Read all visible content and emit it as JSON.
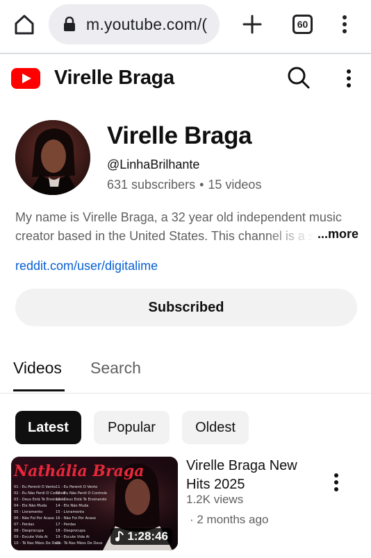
{
  "browser": {
    "url": "m.youtube.com/(",
    "tab_count": "60"
  },
  "header": {
    "channel_title": "Virelle Braga"
  },
  "channel": {
    "name": "Virelle Braga",
    "handle": "@LinhaBrilhante",
    "subscribers": "631 subscribers",
    "videos": "15 videos",
    "separator": "•",
    "description_line1": "My name is Virelle Braga, a 32 year old independent music",
    "description_line2": "creator based in the United States. This channel is a s",
    "more_label": "...more",
    "link": "reddit.com/user/digitalime",
    "subscribe_label": "Subscribed"
  },
  "tabs": [
    {
      "label": "Videos",
      "active": true
    },
    {
      "label": "Search",
      "active": false
    }
  ],
  "chips": [
    {
      "label": "Latest",
      "selected": true
    },
    {
      "label": "Popular",
      "selected": false
    },
    {
      "label": "Oldest",
      "selected": false
    }
  ],
  "videos": [
    {
      "title": "Virelle Braga New Hits 2025",
      "views": "1.2K views",
      "age": "· 2 months ago",
      "duration": "1:28:46",
      "thumbnail_text": "Nathália Braga",
      "thumbnail_tracks_left": [
        "01 - Eu Perenti O Vento",
        "02 - Eu Não Perdi O Controle",
        "03 - Deus Está Te Ensinando",
        "04 - Ele Não Muda",
        "05 - Livramento",
        "06 - Não Foi Por Acaso",
        "07 - Perdas",
        "08 - Desprocupa",
        "09 - Escute Vida Ai",
        "10 - Tá Nas Mãos De Deus"
      ],
      "thumbnail_tracks_right": [
        "11 - Eu Perenti O Vento",
        "12 - Eu Não Perdi O Controle",
        "13 - Deus Está Te Ensinando",
        "14 - Ele Não Muda",
        "15 - Livramento",
        "16 - Não Foi Por Acaso",
        "17 - Perdas",
        "18 - Desprocupa",
        "19 - Escute Vida Ai",
        "20 - Tá Nas Mãos De Deus"
      ]
    }
  ],
  "colors": {
    "brand_red": "#ff0000",
    "link_blue": "#065fd4",
    "muted_text": "#606060",
    "chip_bg": "#f2f2f2",
    "thumbnail_title": "#e8283a"
  }
}
